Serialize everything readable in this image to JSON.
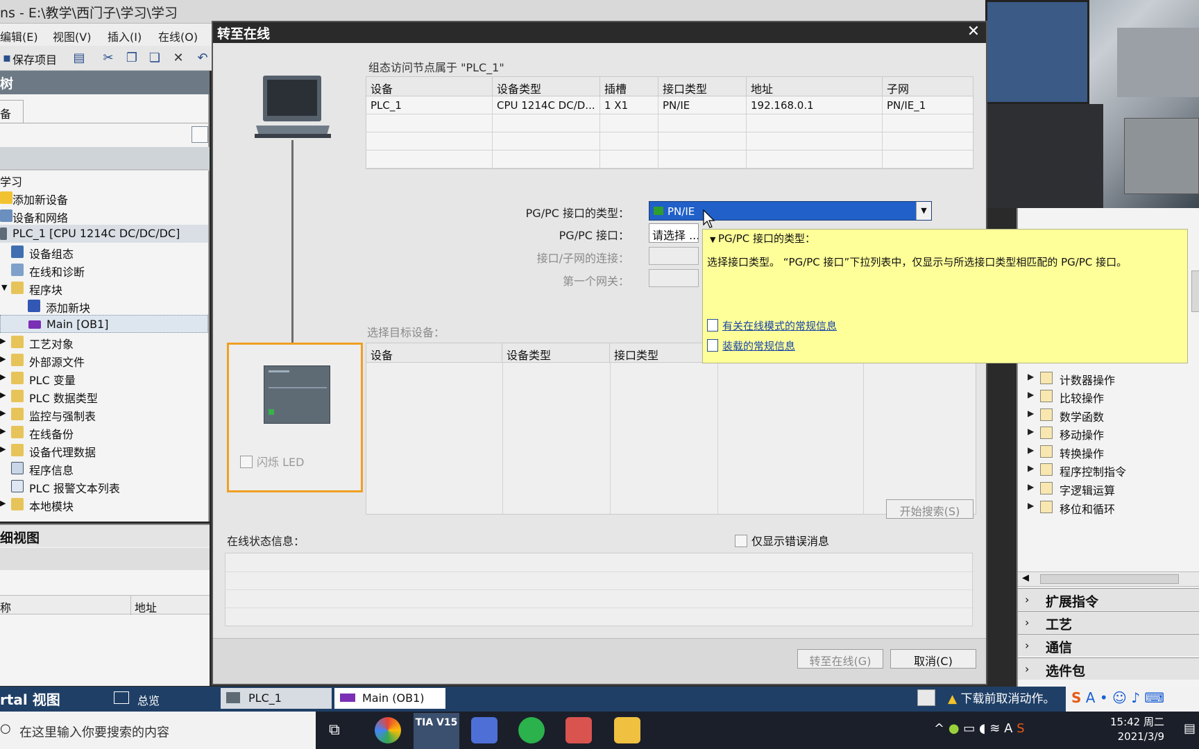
{
  "app": {
    "title": "ns - E:\\教学\\西门子\\学习\\学习",
    "menu": [
      "编辑(E)",
      "视图(V)",
      "插入(I)",
      "在线(O)"
    ],
    "save_label": "保存项目"
  },
  "project_tree": {
    "header": "树",
    "tab": "备",
    "sub_title": "学习",
    "items": [
      {
        "label": "添加新设备"
      },
      {
        "label": "设备和网络"
      },
      {
        "label": "PLC_1 [CPU 1214C DC/DC/DC]"
      },
      {
        "label": "设备组态"
      },
      {
        "label": "在线和诊断"
      },
      {
        "label": "程序块"
      },
      {
        "label": "添加新块"
      },
      {
        "label": "Main [OB1]"
      },
      {
        "label": "工艺对象"
      },
      {
        "label": "外部源文件"
      },
      {
        "label": "PLC 变量"
      },
      {
        "label": "PLC 数据类型"
      },
      {
        "label": "监控与强制表"
      },
      {
        "label": "在线备份"
      },
      {
        "label": "设备代理数据"
      },
      {
        "label": "程序信息"
      },
      {
        "label": "PLC 报警文本列表"
      },
      {
        "label": "本地模块"
      }
    ]
  },
  "detail_view": {
    "header": "细视图",
    "col_name": "称",
    "col_address": "地址"
  },
  "dialog": {
    "title": "转至在线",
    "config_caption": "组态访问节点属于 \"PLC_1\"",
    "config_headers": [
      "设备",
      "设备类型",
      "插槽",
      "接口类型",
      "地址",
      "子网"
    ],
    "config_row": [
      "PLC_1",
      "CPU 1214C DC/D...",
      "1 X1",
      "PN/IE",
      "192.168.0.1",
      "PN/IE_1"
    ],
    "pgpc_type_label": "PG/PC 接口的类型：",
    "pgpc_type_value": "PN/IE",
    "pgpc_iface_label": "PG/PC 接口：",
    "pgpc_iface_value": "请选择 ...",
    "subnet_conn_label": "接口/子网的连接：",
    "gateway_label": "第一个网关：",
    "target_caption": "选择目标设备：",
    "target_headers": [
      "设备",
      "设备类型",
      "接口类型",
      "",
      ""
    ],
    "flash_led": "闪烁 LED",
    "start_search": "开始搜索(S)",
    "status_label": "在线状态信息：",
    "only_errors": "仅显示错误消息",
    "go_online": "转至在线(G)",
    "cancel": "取消(C)",
    "tooltip": {
      "title": "PG/PC 接口的类型：",
      "body": "选择接口类型。 “PG/PC 接口”下拉列表中，仅显示与所选接口类型相匹配的 PG/PC 接口。",
      "link1": "有关在线模式的常规信息",
      "link2": "装载的常规信息"
    }
  },
  "library": {
    "items": [
      "计数器操作",
      "比较操作",
      "数学函数",
      "移动操作",
      "转换操作",
      "程序控制指令",
      "字逻辑运算",
      "移位和循环"
    ],
    "sections": [
      "扩展指令",
      "工艺",
      "通信",
      "选件包"
    ]
  },
  "statusbar": {
    "portal": "rtal 视图",
    "tabs": [
      "总览",
      "PLC_1",
      "Main (OB1)"
    ],
    "warning": "下载前取消动作。"
  },
  "taskbar": {
    "search_placeholder": "在这里输入你要搜索的内容",
    "time": "15:42 周二",
    "date": "2021/3/9",
    "tia": "TIA V15"
  }
}
